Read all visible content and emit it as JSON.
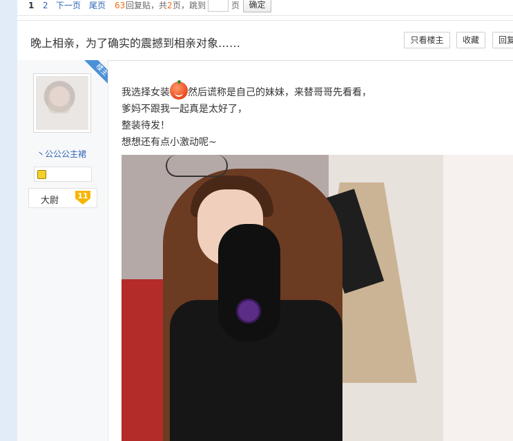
{
  "pager": {
    "current": "1",
    "page2": "2",
    "next": "下一页",
    "last": "尾页",
    "reply_count": "63",
    "reply_text": "回复贴，共",
    "total_pages": "2",
    "pages_jump": "页，跳到",
    "page_unit": "页",
    "jump_value": "",
    "confirm": "确定"
  },
  "thread": {
    "title": "晚上相亲，为了确实的震撼到相亲对象……",
    "buttons": {
      "only_op": "只看楼主",
      "favorite": "收藏",
      "reply": "回复"
    }
  },
  "author": {
    "badge": "楼主",
    "name": "丶公公公主裙",
    "rank": "大尉",
    "level": "11"
  },
  "post": {
    "line1_a": "我选择女装",
    "line1_b": "然后谎称是自己的妹妹，来替哥哥先看看，",
    "line2": "爹妈不跟我一起真是太好了，",
    "line3": "整装待发！",
    "line4": "想想还有点小激动呢~",
    "emoji": "orange-smile-emoji"
  },
  "colors": {
    "link": "#2d64b3",
    "accent": "#f26c10",
    "badge": "#4a90d6"
  }
}
